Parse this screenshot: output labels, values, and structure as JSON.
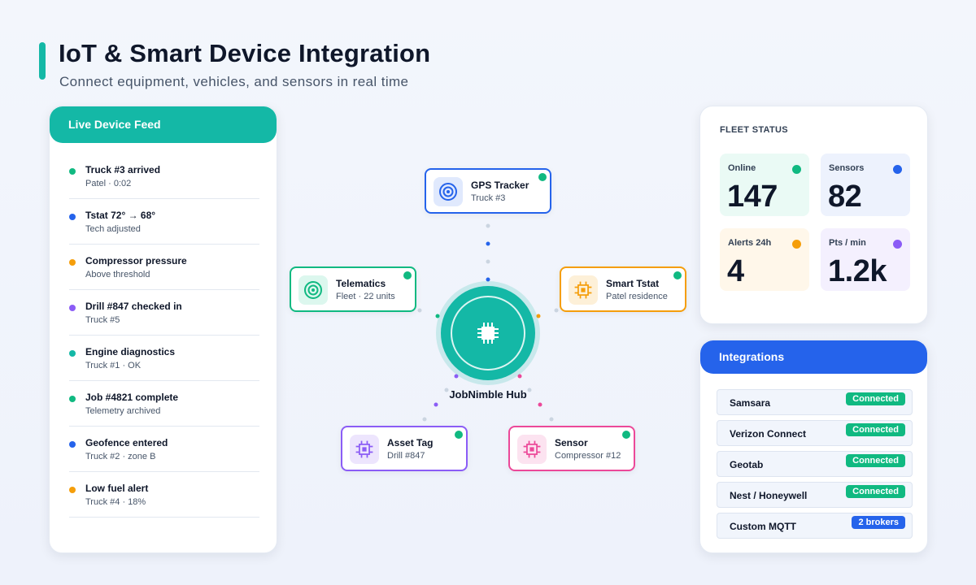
{
  "header": {
    "title": "IoT & Smart Device Integration",
    "subtitle": "Connect equipment, vehicles, and sensors in real time"
  },
  "feed": {
    "title": "Live Device Feed",
    "items": [
      {
        "title": "Truck #3 arrived",
        "subtitle": "Patel · 0:02",
        "color": "#10b981"
      },
      {
        "title": "Tstat 72° → 68°",
        "subtitle": "Tech adjusted",
        "color": "#2563eb"
      },
      {
        "title": "Compressor pressure",
        "subtitle": "Above threshold",
        "color": "#f59e0b"
      },
      {
        "title": "Drill #847 checked in",
        "subtitle": "Truck #5",
        "color": "#8b5cf6"
      },
      {
        "title": "Engine diagnostics",
        "subtitle": "Truck #1 · OK",
        "color": "#14b8a6"
      },
      {
        "title": "Job #4821 complete",
        "subtitle": "Telemetry archived",
        "color": "#10b981"
      },
      {
        "title": "Geofence entered",
        "subtitle": "Truck #2 · zone B",
        "color": "#2563eb"
      },
      {
        "title": "Low fuel alert",
        "subtitle": "Truck #4 · 18%",
        "color": "#f59e0b"
      }
    ]
  },
  "hub": {
    "label": "JobNimble Hub",
    "color": "#14b8a6"
  },
  "nodes": {
    "gps": {
      "title": "GPS Tracker",
      "subtitle": "Truck #3",
      "color": "#2563eb",
      "icon": "target-icon"
    },
    "telematics": {
      "title": "Telematics",
      "subtitle": "Fleet · 22 units",
      "color": "#10b981",
      "icon": "target-icon"
    },
    "tstat": {
      "title": "Smart Tstat",
      "subtitle": "Patel residence",
      "color": "#f59e0b",
      "icon": "chip-icon"
    },
    "asset": {
      "title": "Asset Tag",
      "subtitle": "Drill #847",
      "color": "#8b5cf6",
      "icon": "chip-icon"
    },
    "sensor": {
      "title": "Sensor",
      "subtitle": "Compressor #12",
      "color": "#ec4899",
      "icon": "chip-icon"
    }
  },
  "fleet": {
    "title": "FLEET STATUS",
    "stats": [
      {
        "label": "Online",
        "value": "147",
        "color": "#10b981",
        "bg": "#eafaf5"
      },
      {
        "label": "Sensors",
        "value": "82",
        "color": "#2563eb",
        "bg": "#edf2fd"
      },
      {
        "label": "Alerts 24h",
        "value": "4",
        "color": "#f59e0b",
        "bg": "#fff7ea"
      },
      {
        "label": "Pts / min",
        "value": "1.2k",
        "color": "#8b5cf6",
        "bg": "#f4f0fe"
      }
    ]
  },
  "integrations": {
    "title": "Integrations",
    "items": [
      {
        "name": "Samsara",
        "status": "Connected",
        "color": "#10b981"
      },
      {
        "name": "Verizon Connect",
        "status": "Connected",
        "color": "#10b981"
      },
      {
        "name": "Geotab",
        "status": "Connected",
        "color": "#10b981"
      },
      {
        "name": "Nest / Honeywell",
        "status": "Connected",
        "color": "#10b981"
      },
      {
        "name": "Custom MQTT",
        "status": "2 brokers",
        "color": "#2563eb"
      }
    ]
  }
}
